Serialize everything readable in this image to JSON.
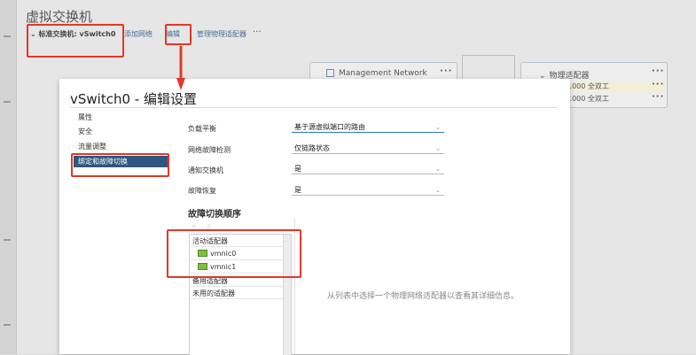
{
  "background": {
    "page_title": "虚拟交换机",
    "switch_label": "标准交换机: vSwitch0",
    "toolbar": {
      "add_network": "添加网络",
      "edit": "编辑",
      "manage_adapters": "管理物理适配器",
      "more": "···"
    },
    "portgroup_label": "Management Network",
    "physical_adapters_title": "物理适配器",
    "adapter_rows": [
      "1000 全双工",
      "1000 全双工"
    ],
    "ellipsis": "···"
  },
  "dialog": {
    "title": "vSwitch0 - 编辑设置",
    "sidebar": [
      {
        "label": "属性"
      },
      {
        "label": "安全"
      },
      {
        "label": "流量调整"
      },
      {
        "label": "绑定和故障切换"
      }
    ],
    "fields": {
      "load_balancing": {
        "label": "负载平衡",
        "value": "基于源虚拟端口的路由"
      },
      "failure_detection": {
        "label": "网络故障检测",
        "value": "仅链路状态"
      },
      "notify_switches": {
        "label": "通知交换机",
        "value": "是"
      },
      "failback": {
        "label": "故障恢复",
        "value": "是"
      }
    },
    "failover_order": {
      "heading": "故障切换顺序",
      "move_up": "⇧",
      "move_down": "⇩",
      "active_group": "活动适配器",
      "active_nics": [
        "vmnic0",
        "vmnic1"
      ],
      "standby_group": "备用适配器",
      "unused_group": "未用的适配器"
    },
    "detail_hint": "从列表中选择一个物理网络适配器以查看其详细信息。"
  },
  "colors": {
    "accent_red": "#e0382a",
    "selected_nav": "#2f567f",
    "nic_green": "#7fbf3f"
  }
}
